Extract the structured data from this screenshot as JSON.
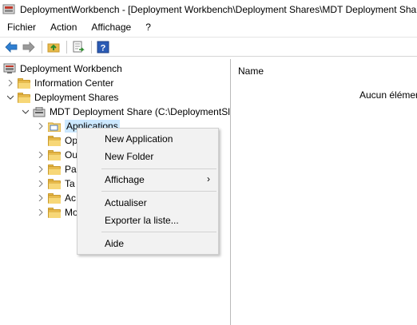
{
  "window": {
    "title": "DeploymentWorkbench - [Deployment Workbench\\Deployment Shares\\MDT Deployment Shar"
  },
  "menubar": {
    "items": [
      "Fichier",
      "Action",
      "Affichage",
      "?"
    ]
  },
  "toolbar": {
    "icons": [
      "back-arrow-icon",
      "forward-arrow-icon",
      "up-folder-icon",
      "export-list-icon",
      "help-icon"
    ]
  },
  "tree": {
    "root": "Deployment Workbench",
    "information_center": "Information Center",
    "deployment_shares": "Deployment Shares",
    "mdt_share": "MDT Deployment Share (C:\\DeploymentSl",
    "applications": "Applications",
    "child_fragments": [
      "Op",
      "Ou",
      "Pa",
      "Ta",
      "Ac",
      "Mo"
    ]
  },
  "right_pane": {
    "column_header": "Name",
    "empty_message": "Aucun élémen"
  },
  "context_menu": {
    "new_application": "New Application",
    "new_folder": "New Folder",
    "affichage": "Affichage",
    "actualiser": "Actualiser",
    "exporter": "Exporter la liste...",
    "aide": "Aide",
    "submenu_arrow": "›"
  },
  "colors": {
    "selection": "#cce8ff",
    "folder": "#e8b94a",
    "menu_bg": "#f2f2f2"
  }
}
